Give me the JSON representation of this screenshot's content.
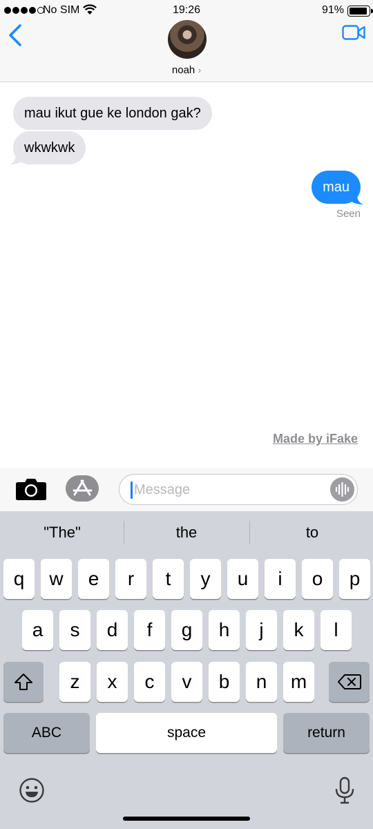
{
  "status_bar": {
    "carrier": "No SIM",
    "time": "19:26",
    "battery_percent": "91%",
    "battery_level": 0.91
  },
  "header": {
    "contact_name": "noah",
    "chevron": "›",
    "back_icon": "chevron-left-icon",
    "video_icon": "video-camera-icon",
    "accent_color": "#1B8BFF"
  },
  "messages": [
    {
      "direction": "received",
      "text": "mau ikut gue ke london gak?"
    },
    {
      "direction": "received",
      "text": "wkwkwk"
    },
    {
      "direction": "sent",
      "text": "mau"
    }
  ],
  "read_receipt": "Seen",
  "watermark": "Made by iFake",
  "input_bar": {
    "placeholder": "Message",
    "camera_icon": "camera-icon",
    "appstore_icon": "app-store-icon",
    "audio_icon": "audio-waveform-icon"
  },
  "keyboard": {
    "suggestions": [
      "\"The\"",
      "the",
      "to"
    ],
    "row1": [
      "q",
      "w",
      "e",
      "r",
      "t",
      "y",
      "u",
      "i",
      "o",
      "p"
    ],
    "row2": [
      "a",
      "s",
      "d",
      "f",
      "g",
      "h",
      "j",
      "k",
      "l"
    ],
    "row3": [
      "z",
      "x",
      "c",
      "v",
      "b",
      "n",
      "m"
    ],
    "abc_label": "ABC",
    "space_label": "space",
    "return_label": "return",
    "shift_icon": "shift-icon",
    "delete_icon": "delete-icon",
    "emoji_icon": "emoji-icon",
    "mic_icon": "microphone-icon"
  }
}
